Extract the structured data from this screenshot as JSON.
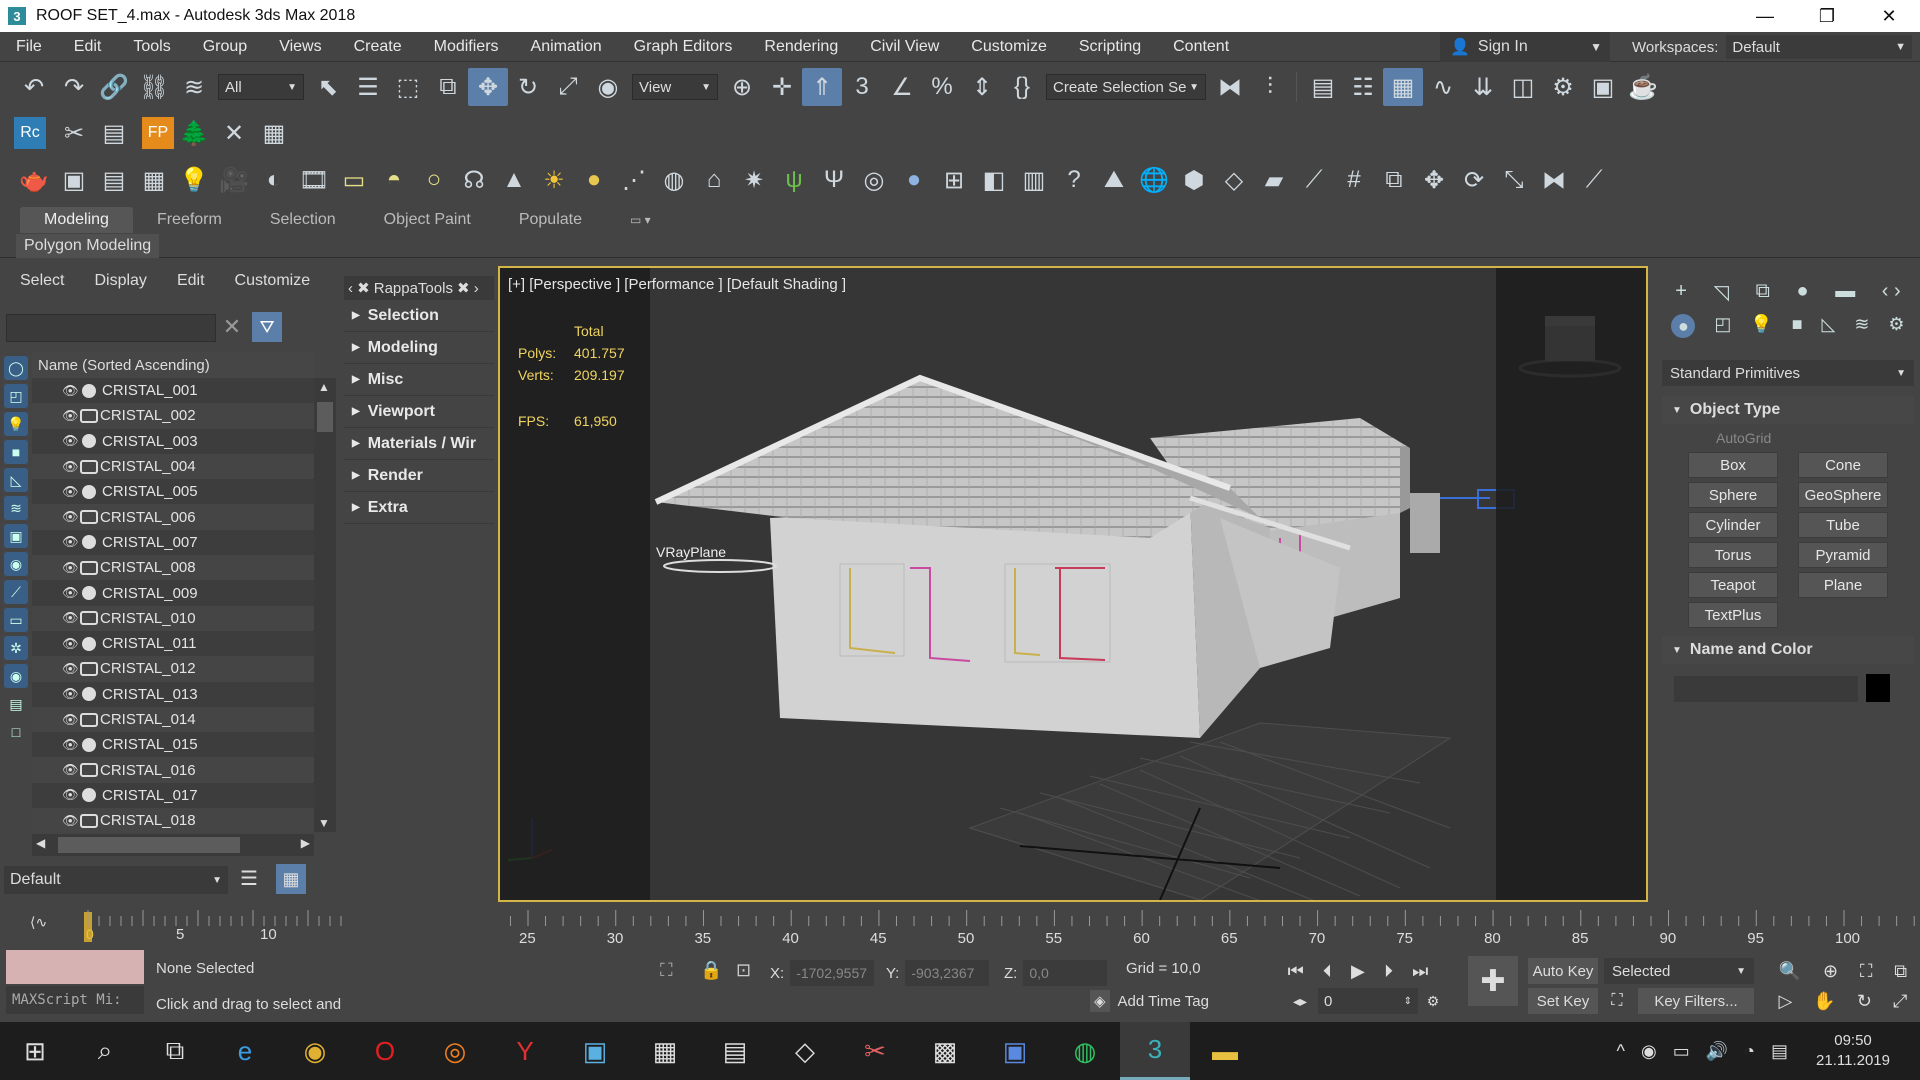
{
  "window": {
    "title": "ROOF SET_4.max - Autodesk 3ds Max 2018",
    "app_icon": "3",
    "minimize": "—",
    "restore": "❐",
    "close": "✕"
  },
  "menu": [
    "File",
    "Edit",
    "Tools",
    "Group",
    "Views",
    "Create",
    "Modifiers",
    "Animation",
    "Graph Editors",
    "Rendering",
    "Civil View",
    "Customize",
    "Scripting",
    "Content"
  ],
  "signin": {
    "label": "Sign In"
  },
  "workspaces": {
    "label": "Workspaces:",
    "value": "Default"
  },
  "toolbar": {
    "selection_filter": "All",
    "ref_coord": "View",
    "named_selection": "Create Selection Se"
  },
  "ribbon": {
    "tabs": [
      "Modeling",
      "Freeform",
      "Selection",
      "Object Paint",
      "Populate"
    ],
    "panel_label": "Polygon Modeling"
  },
  "scene_explorer": {
    "menu": [
      "Select",
      "Display",
      "Edit",
      "Customize"
    ],
    "header": "Name (Sorted Ascending)",
    "items": [
      {
        "name": "CRISTAL_001",
        "group": false
      },
      {
        "name": "CRISTAL_002",
        "group": true
      },
      {
        "name": "CRISTAL_003",
        "group": false
      },
      {
        "name": "CRISTAL_004",
        "group": true
      },
      {
        "name": "CRISTAL_005",
        "group": false
      },
      {
        "name": "CRISTAL_006",
        "group": true
      },
      {
        "name": "CRISTAL_007",
        "group": false
      },
      {
        "name": "CRISTAL_008",
        "group": true
      },
      {
        "name": "CRISTAL_009",
        "group": false
      },
      {
        "name": "CRISTAL_010",
        "group": true
      },
      {
        "name": "CRISTAL_011",
        "group": false
      },
      {
        "name": "CRISTAL_012",
        "group": true
      },
      {
        "name": "CRISTAL_013",
        "group": false
      },
      {
        "name": "CRISTAL_014",
        "group": true
      },
      {
        "name": "CRISTAL_015",
        "group": false
      },
      {
        "name": "CRISTAL_016",
        "group": true
      },
      {
        "name": "CRISTAL_017",
        "group": false
      },
      {
        "name": "CRISTAL_018",
        "group": true
      }
    ],
    "layer": "Default"
  },
  "rappatools": {
    "title": "RappaTools",
    "items": [
      "Selection",
      "Modeling",
      "Misc",
      "Viewport",
      "Materials / Wir",
      "Render",
      "Extra"
    ]
  },
  "viewport": {
    "label": "[+] [Perspective ] [Performance ] [Default Shading ]",
    "stats": {
      "total_label": "Total",
      "polys_label": "Polys:",
      "polys": "401.757",
      "verts_label": "Verts:",
      "verts": "209.197",
      "fps_label": "FPS:",
      "fps": "61,950"
    },
    "vray_label": "VRayPlane",
    "colors": {
      "border": "#d4b548",
      "roof": "#c8c8c8",
      "wall": "#cfcfcf"
    }
  },
  "command_panel": {
    "category": "Standard Primitives",
    "object_type_title": "Object Type",
    "autogrid": "AutoGrid",
    "primitives": [
      "Box",
      "Cone",
      "Sphere",
      "GeoSphere",
      "Cylinder",
      "Tube",
      "Torus",
      "Pyramid",
      "Teapot",
      "Plane",
      "TextPlus"
    ],
    "name_color_title": "Name and Color"
  },
  "timeline": {
    "left_frame": "0",
    "left_ticks": [
      "0",
      "5",
      "10"
    ],
    "ticks": [
      "25",
      "30",
      "35",
      "40",
      "45",
      "50",
      "55",
      "60",
      "65",
      "70",
      "75",
      "80",
      "85",
      "90",
      "95",
      "100"
    ]
  },
  "status": {
    "maxscript": "MAXScript Mi:",
    "selection": "None Selected",
    "prompt": "Click and drag to select and",
    "x_label": "X:",
    "x": "-1702,9557",
    "y_label": "Y:",
    "y": "-903,2367",
    "z_label": "Z:",
    "z": "0,0",
    "grid": "Grid = 10,0",
    "add_time_tag": "Add Time Tag",
    "auto_key": "Auto Key",
    "set_key": "Set Key",
    "key_mode": "Selected",
    "frame": "0",
    "key_filters": "Key Filters..."
  },
  "taskbar": {
    "time": "09:50",
    "date": "21.11.2019"
  }
}
